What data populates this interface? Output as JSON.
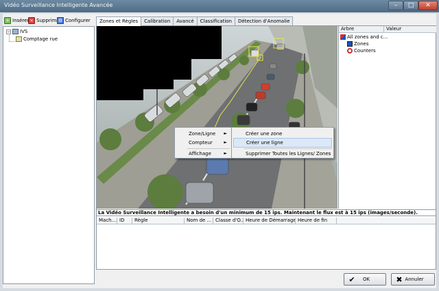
{
  "window": {
    "title": "Vidéo Surveillance Intelligente Avancée",
    "min_glyph": "–",
    "max_glyph": "□",
    "close_glyph": "✕"
  },
  "toolbar": {
    "insert_label": "Insérer",
    "delete_label": "Supprimer",
    "configure_label": "Configurer"
  },
  "tree": {
    "root_label": "IVS",
    "child_label": "Comptage rue"
  },
  "tabs": [
    {
      "label": "Zones et Règles"
    },
    {
      "label": "Calibration"
    },
    {
      "label": "Avancé"
    },
    {
      "label": "Classification"
    },
    {
      "label": "Détection d'Anomalie"
    }
  ],
  "property_grid": {
    "col_tree": "Arbre",
    "col_value": "Valeur",
    "rows": [
      {
        "label": "All zones and c..."
      },
      {
        "label": "Zones"
      },
      {
        "label": "Counters"
      }
    ]
  },
  "context_menu": {
    "items": [
      {
        "label": "Zone/Ligne",
        "arrow": "►"
      },
      {
        "label": "Compteur",
        "arrow": "►"
      },
      {
        "label": "Affichage",
        "arrow": "►"
      }
    ],
    "submenu": [
      {
        "label": "Créer une zone"
      },
      {
        "label": "Créer une ligne"
      },
      {
        "label": "Supprimer Toutes les Lignes/ Zones"
      }
    ]
  },
  "info_message": "La Vidéo Surveillance  Intelligente a besoin d'un minimum de 15 ips. Maintenant le flux est à 15 ips (images/seconde).",
  "table": {
    "columns": [
      {
        "label": "Mach..."
      },
      {
        "label": "ID"
      },
      {
        "label": "Règle"
      },
      {
        "label": "Nom de ..."
      },
      {
        "label": "Classe d'O..."
      },
      {
        "label": "Heure de Démarrage"
      },
      {
        "label": "Heure de fin"
      }
    ]
  },
  "buttons": {
    "ok_label": "OK",
    "cancel_label": "Annuler",
    "ok_glyph": "✔",
    "cancel_glyph": "✖"
  },
  "colors": {
    "accent": "#4f6b85",
    "zone_line": "#e8e84a",
    "menu_highlight": "#dce8f6"
  }
}
